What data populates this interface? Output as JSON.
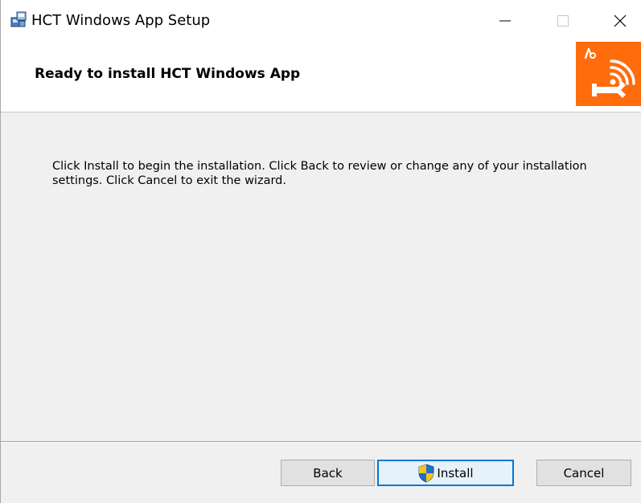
{
  "window": {
    "title": "HCT Windows App Setup",
    "controls": {
      "minimize": "minimize-icon",
      "maximize": "maximize-icon",
      "close": "close-icon"
    }
  },
  "header": {
    "title": "Ready to install HCT Windows App",
    "logo": "hct-tool-wireless-logo",
    "logo_color": "#ff6c0c"
  },
  "body": {
    "message": "Click Install to begin the installation. Click Back to review or change any of your installation settings. Click Cancel to exit the wizard."
  },
  "buttons": {
    "back": "Back",
    "install": "Install",
    "cancel": "Cancel"
  },
  "colors": {
    "focus_border": "#0078d7",
    "background": "#f0f0f0"
  }
}
